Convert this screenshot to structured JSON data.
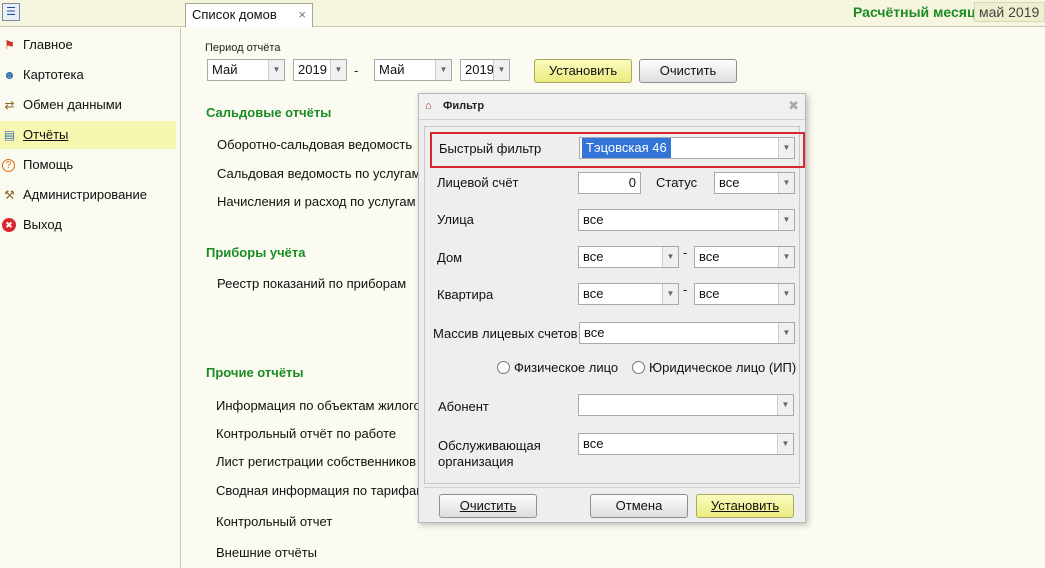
{
  "topbar": {
    "menu_icon": "app-menu-icon",
    "tab_label": "Список домов",
    "tab_close": "×",
    "period_label": "Расчётный месяц",
    "period_value": "май 2019"
  },
  "sidebar": {
    "items": [
      {
        "label": "Главное",
        "icon": "flag-icon",
        "glyph": "⚑",
        "color": "#c8352a"
      },
      {
        "label": "Картотека",
        "icon": "people-icon",
        "glyph": "☻",
        "color": "#3a6fb0"
      },
      {
        "label": "Обмен данными",
        "icon": "exchange-icon",
        "glyph": "⇄",
        "color": "#8a6a24"
      },
      {
        "label": "Отчёты",
        "icon": "reports-icon",
        "glyph": "▤",
        "color": "#4a78b8"
      },
      {
        "label": "Помощь",
        "icon": "help-icon",
        "glyph": "?",
        "color": "#e06a12"
      },
      {
        "label": "Администрирование",
        "icon": "admin-icon",
        "glyph": "⚒",
        "color": "#8a6a24"
      },
      {
        "label": "Выход",
        "icon": "exit-icon",
        "glyph": "✖",
        "color": "#d9262f"
      }
    ]
  },
  "report_period": {
    "label": "Период отчёта",
    "from_month": "Май",
    "from_year": "2019",
    "separator": "-",
    "to_month": "Май",
    "to_year": "2019",
    "set_button": "Установить",
    "clear_button": "Очистить"
  },
  "sections": {
    "balance": {
      "title": "Сальдовые отчёты",
      "items": [
        "Оборотно-сальдовая ведомость",
        "Сальдовая ведомость по услугам",
        "Начисления и расход по услугам"
      ]
    },
    "meters": {
      "title": "Приборы учёта",
      "items": [
        "Реестр показаний по приборам"
      ]
    },
    "other": {
      "title": "Прочие отчёты",
      "items": [
        "Информация по объектам жилого фонда",
        "Контрольный отчёт по работе",
        "Лист регистрации собственников",
        "Сводная информация по тарифам",
        "Контрольный отчет",
        "Внешние отчёты"
      ]
    }
  },
  "filter_dialog": {
    "title": "Фильтр",
    "close": "✖",
    "quick_filter_label": "Быстрый фильтр",
    "quick_filter_value": "Тэцовская 46",
    "account_label": "Лицевой счёт",
    "account_value": "0",
    "status_label": "Статус",
    "status_value": "все",
    "street_label": "Улица",
    "street_value": "все",
    "house_label": "Дом",
    "house_from": "все",
    "house_to": "все",
    "apartment_label": "Квартира",
    "apartment_from": "все",
    "apartment_to": "все",
    "range_sep": "-",
    "accounts_array_label": "Массив лицевых счетов",
    "accounts_array_value": "все",
    "radio_individual": "Физическое лицо",
    "radio_legal": "Юридическое лицо (ИП)",
    "subscriber_label": "Абонент",
    "subscriber_value": "",
    "org_label_line1": "Обслуживающая",
    "org_label_line2": "организация",
    "org_value": "все",
    "clear_button": "Очистить",
    "cancel_button": "Отмена",
    "apply_button": "Установить"
  },
  "colors": {
    "accent_green": "#1a8c24",
    "highlight_red": "#d9262f",
    "selection_blue": "#3374d8",
    "active_yellow": "#f6f7b0"
  }
}
